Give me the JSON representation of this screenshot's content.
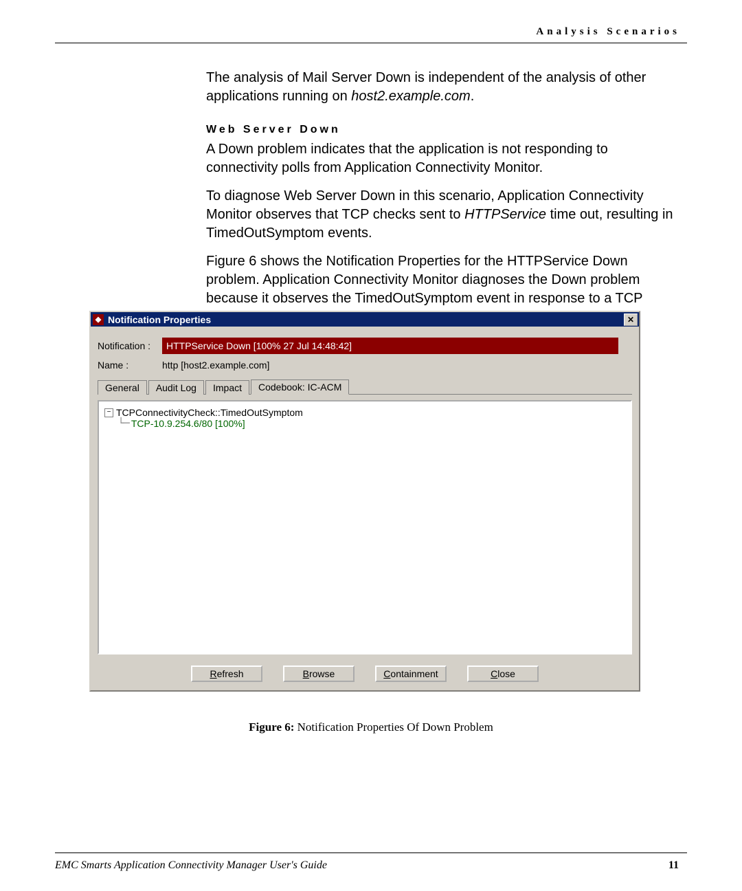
{
  "header": {
    "section": "Analysis Scenarios"
  },
  "body": {
    "p1a": "The analysis of Mail Server Down is independent of the analysis of other applications running on ",
    "p1host": "host2.example.com",
    "p1b": ".",
    "h2": "Web Server Down",
    "p2": "A Down problem indicates that the application is not responding to connectivity polls from Application Connectivity Monitor.",
    "p3a": "To diagnose Web Server Down in this scenario, Application Connectivity Monitor observes that TCP checks sent to ",
    "p3svc": "HTTPService",
    "p3b": " time out, resulting in TimedOutSymptom events.",
    "p4": "Figure 6 shows the Notification Properties for the HTTPService Down problem. Application Connectivity Monitor diagnoses the Down problem because it observes the TimedOutSymptom event in response to a TCP check."
  },
  "window": {
    "title": "Notification Properties",
    "fields": {
      "notification_label": "Notification :",
      "notification_value": "HTTPService Down  [100% 27 Jul 14:48:42]",
      "name_label": "Name :",
      "name_value": "http [host2.example.com]"
    },
    "tabs": [
      "General",
      "Audit Log",
      "Impact",
      "Codebook: IC-ACM"
    ],
    "tree": {
      "toggle": "−",
      "root": "TCPConnectivityCheck::TimedOutSymptom",
      "child": "TCP-10.9.254.6/80 [100%]"
    },
    "buttons": [
      "Refresh",
      "Browse",
      "Containment",
      "Close"
    ]
  },
  "caption": {
    "bold": "Figure 6:",
    "rest": " Notification Properties Of Down Problem"
  },
  "footer": {
    "left": "EMC Smarts Application Connectivity Manager User's Guide",
    "page": "11"
  }
}
